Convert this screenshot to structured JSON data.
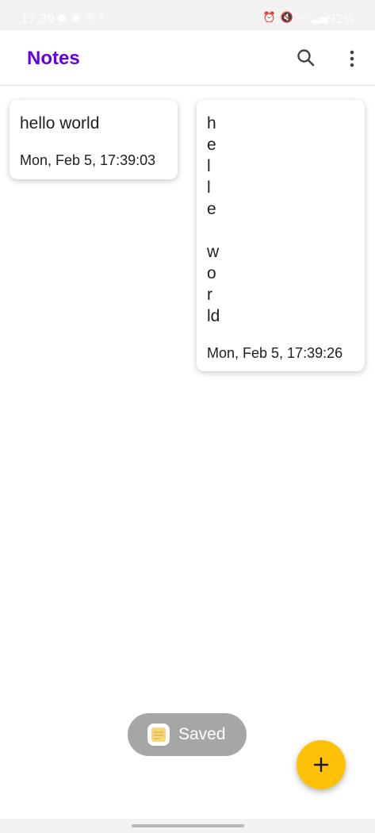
{
  "status_bar": {
    "time": "17:39",
    "battery": "92%",
    "left_icons": [
      "person-icon",
      "image-icon",
      "gmail-icon",
      "dot-icon"
    ],
    "right_icons": [
      "alarm-icon",
      "mute-icon",
      "wifi-icon",
      "signal-icon",
      "signal-icon",
      "battery-icon"
    ]
  },
  "app_bar": {
    "title": "Notes",
    "title_color": "#6200ee",
    "actions": [
      "search-icon",
      "more-vert-icon"
    ]
  },
  "notes": [
    {
      "body": "hello world",
      "date": "Mon, Feb 5, 17:39:03"
    },
    {
      "body": "h\ne\nl\nl\ne\n\nw\no\nr\nld",
      "date": "Mon, Feb 5, 17:39:26"
    }
  ],
  "toast": {
    "label": "Saved",
    "icon": "sticky-note-icon"
  },
  "fab": {
    "icon": "plus-icon",
    "color": "#ffc107"
  }
}
